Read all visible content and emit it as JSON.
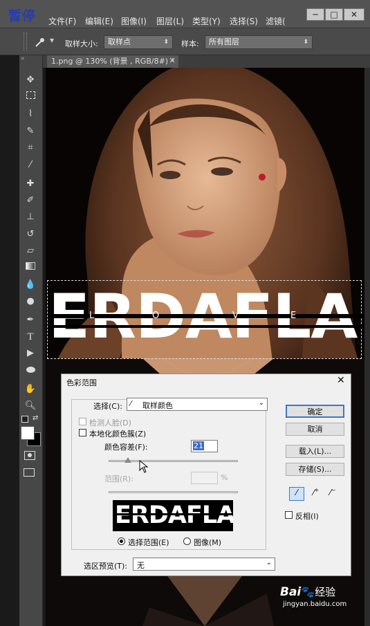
{
  "overlay": {
    "pause_label": "暂停"
  },
  "menu": {
    "items": [
      "文件(F)",
      "编辑(E)",
      "图像(I)",
      "图层(L)",
      "类型(Y)",
      "选择(S)",
      "滤镜("
    ]
  },
  "window_controls": {
    "minimize": "─",
    "maximize": "□",
    "close": "✕"
  },
  "options": {
    "sample_size_label": "取样大小:",
    "sample_size_value": "取样点",
    "sample_label": "样本:",
    "sample_value": "所有图层"
  },
  "document": {
    "tab_title": "1.png @ 130% (背景 , RGB/8#) *",
    "tab_close": "×"
  },
  "artwork": {
    "headline": "ERDAFLA",
    "love": [
      "L",
      "O",
      "V",
      "E"
    ]
  },
  "dialog": {
    "title": "色彩范围",
    "select_label": "选择(C):",
    "select_value": "取样颜色",
    "detect_faces_label": "检测人脸(D)",
    "localized_label": "本地化颜色簇(Z)",
    "fuzziness_label": "颜色容差(F):",
    "fuzziness_value": "21",
    "fuzziness_fraction": 0.15,
    "range_label": "范围(R):",
    "range_unit": "%",
    "preview_text": "ERDAFLA",
    "radio_selection_label": "选择范围(E)",
    "radio_image_label": "图像(M)",
    "preview_label": "选区预览(T):",
    "preview_value": "无",
    "ok_label": "确定",
    "cancel_label": "取消",
    "load_label": "载入(L)...",
    "save_label": "存储(S)...",
    "invert_label": "反相(I)"
  },
  "watermark": {
    "logo": "Bai",
    "logo2": "经验",
    "url": "jingyan.baidu.com"
  }
}
